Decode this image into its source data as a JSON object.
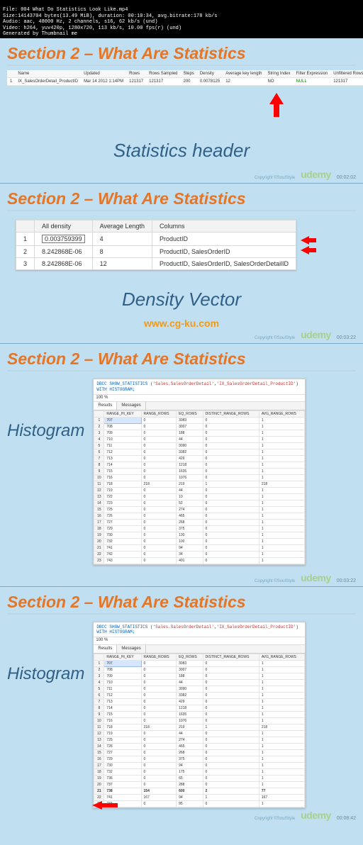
{
  "terminal": {
    "line1": "File: 004 What Do Statistics Look Like.mp4",
    "line2": "Size:14143704 bytes(13.49 MiB), duration: 00:10:34, avg.bitrate:178 kb/s",
    "line3": "Audio: aac, 48000 Hz, 2 channels, s16, 62 kb/s (und)",
    "line4": "Video: h264, yuv420p, 1280x720, 113 kb/s, 10.00 fps(r) (und)",
    "line5": "Generated by Thumbnail me"
  },
  "section_title": "Section 2 – What Are Statistics",
  "panel1": {
    "caption": "Statistics header",
    "timecode": "00:02:02",
    "headers": [
      "",
      "Name",
      "Updated",
      "Rows",
      "Rows Sampled",
      "Steps",
      "Density",
      "Average key length",
      "String Index",
      "Filter Expression",
      "Unfiltered Rows"
    ],
    "row": [
      "1",
      "IX_SalesOrderDetail_ProductID",
      "Mar 14 2012  1:14PM",
      "121317",
      "121317",
      "200",
      "0.0078125",
      "12",
      "NO",
      "NULL",
      "121317"
    ]
  },
  "panel2": {
    "caption": "Density Vector",
    "watermark": "www.cg-ku.com",
    "timecode": "00:03:22",
    "headers": [
      "",
      "All density",
      "Average Length",
      "Columns"
    ],
    "rows": [
      [
        "1",
        "0.003759399",
        "4",
        "ProductID"
      ],
      [
        "2",
        "8.242868E-06",
        "8",
        "ProductID, SalesOrderID"
      ],
      [
        "3",
        "8.242868E-06",
        "12",
        "ProductID, SalesOrderID, SalesOrderDetailID"
      ]
    ]
  },
  "sql": {
    "cmd_pre": "DBCC SHOW_STATISTICS (",
    "table": "'Sales.SalesOrderDetail'",
    "comma": ",",
    "index": "'IX_SalesOrderDetail_ProductID'",
    "cmd_post": ")",
    "with": "WITH HISTOGRAM;",
    "zoom": "100 %",
    "tab_results": "Results",
    "tab_messages": "Messages"
  },
  "histo": {
    "label": "Histogram",
    "headers": [
      "",
      "RANGE_HI_KEY",
      "RANGE_ROWS",
      "EQ_ROWS",
      "DISTINCT_RANGE_ROWS",
      "AVG_RANGE_ROWS"
    ],
    "rows3": [
      [
        "1",
        "707",
        "0",
        "3083",
        "0",
        "1"
      ],
      [
        "2",
        "708",
        "0",
        "3007",
        "0",
        "1"
      ],
      [
        "3",
        "709",
        "0",
        "188",
        "0",
        "1"
      ],
      [
        "4",
        "710",
        "0",
        "44",
        "0",
        "1"
      ],
      [
        "5",
        "711",
        "0",
        "3090",
        "0",
        "1"
      ],
      [
        "6",
        "712",
        "0",
        "3382",
        "0",
        "1"
      ],
      [
        "7",
        "713",
        "0",
        "429",
        "0",
        "1"
      ],
      [
        "8",
        "714",
        "0",
        "1218",
        "0",
        "1"
      ],
      [
        "9",
        "715",
        "0",
        "1635",
        "0",
        "1"
      ],
      [
        "10",
        "716",
        "0",
        "1076",
        "0",
        "1"
      ],
      [
        "11",
        "718",
        "218",
        "219",
        "1",
        "218"
      ],
      [
        "12",
        "719",
        "0",
        "44",
        "0",
        "1"
      ],
      [
        "13",
        "722",
        "0",
        "10",
        "0",
        "1"
      ],
      [
        "14",
        "723",
        "0",
        "52",
        "0",
        "1"
      ],
      [
        "15",
        "725",
        "0",
        "274",
        "0",
        "1"
      ],
      [
        "16",
        "726",
        "0",
        "465",
        "0",
        "1"
      ],
      [
        "17",
        "727",
        "0",
        "268",
        "0",
        "1"
      ],
      [
        "18",
        "729",
        "0",
        "375",
        "0",
        "1"
      ],
      [
        "19",
        "730",
        "0",
        "130",
        "0",
        "1"
      ],
      [
        "20",
        "732",
        "0",
        "100",
        "0",
        "1"
      ],
      [
        "21",
        "741",
        "0",
        "94",
        "0",
        "1"
      ],
      [
        "22",
        "742",
        "0",
        "34",
        "0",
        "1"
      ],
      [
        "23",
        "743",
        "0",
        "401",
        "0",
        "1"
      ]
    ],
    "rows4": [
      [
        "1",
        "707",
        "0",
        "3083",
        "0",
        "1"
      ],
      [
        "2",
        "708",
        "0",
        "3007",
        "0",
        "1"
      ],
      [
        "3",
        "709",
        "0",
        "188",
        "0",
        "1"
      ],
      [
        "4",
        "710",
        "0",
        "44",
        "0",
        "1"
      ],
      [
        "5",
        "711",
        "0",
        "3090",
        "0",
        "1"
      ],
      [
        "6",
        "712",
        "0",
        "3382",
        "0",
        "1"
      ],
      [
        "7",
        "713",
        "0",
        "429",
        "0",
        "1"
      ],
      [
        "8",
        "714",
        "0",
        "1218",
        "0",
        "1"
      ],
      [
        "9",
        "715",
        "0",
        "1635",
        "0",
        "1"
      ],
      [
        "10",
        "716",
        "0",
        "1076",
        "0",
        "1"
      ],
      [
        "11",
        "718",
        "218",
        "219",
        "1",
        "218"
      ],
      [
        "12",
        "719",
        "0",
        "44",
        "0",
        "1"
      ],
      [
        "13",
        "725",
        "0",
        "274",
        "0",
        "1"
      ],
      [
        "14",
        "726",
        "0",
        "465",
        "0",
        "1"
      ],
      [
        "15",
        "727",
        "0",
        "268",
        "0",
        "1"
      ],
      [
        "16",
        "729",
        "0",
        "375",
        "0",
        "1"
      ],
      [
        "17",
        "730",
        "0",
        "94",
        "0",
        "1"
      ],
      [
        "18",
        "732",
        "0",
        "175",
        "0",
        "1"
      ],
      [
        "19",
        "736",
        "0",
        "65",
        "0",
        "1"
      ],
      [
        "20",
        "737",
        "0",
        "288",
        "0",
        "1"
      ],
      [
        "21",
        "738",
        "154",
        "600",
        "2",
        "77"
      ],
      [
        "22",
        "741",
        "167",
        "94",
        "1",
        "167"
      ],
      [
        "23",
        "743",
        "0",
        "95",
        "0",
        "1"
      ]
    ],
    "highlight_row4": 20
  },
  "panel3_timecode": "00:03:22",
  "panel4_timecode": "00:08:42",
  "logo": "udemy",
  "copyright": "Copyright ©SoulStyle"
}
